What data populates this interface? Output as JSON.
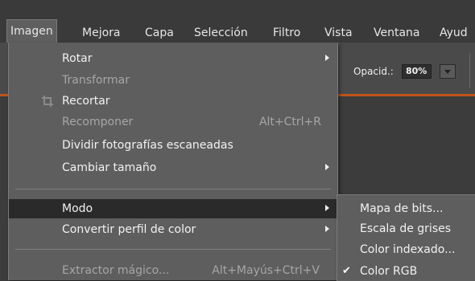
{
  "menubar": {
    "items": [
      "Imagen",
      "Mejora",
      "Capa",
      "Selección",
      "Filtro",
      "Vista",
      "Ventana",
      "Ayud"
    ],
    "active_index": 0
  },
  "options_bar": {
    "opacity_label": "Opacid.:",
    "opacity_value": "80%"
  },
  "image_menu": {
    "items": [
      {
        "label": "Rotar",
        "shortcut": "",
        "enabled": true,
        "submenu": true
      },
      {
        "label": "Transformar",
        "shortcut": "",
        "enabled": false,
        "submenu": false
      },
      {
        "label": "Recortar",
        "shortcut": "",
        "enabled": true,
        "submenu": false,
        "icon": "crop-icon"
      },
      {
        "label": "Recomponer",
        "shortcut": "Alt+Ctrl+R",
        "enabled": false,
        "submenu": false
      },
      {
        "label": "Dividir fotografías escaneadas",
        "shortcut": "",
        "enabled": true,
        "submenu": false
      },
      {
        "label": "Cambiar tamaño",
        "shortcut": "",
        "enabled": true,
        "submenu": true
      },
      {
        "label": "Modo",
        "shortcut": "",
        "enabled": true,
        "submenu": true,
        "highlighted": true
      },
      {
        "label": "Convertir perfil de color",
        "shortcut": "",
        "enabled": true,
        "submenu": true
      },
      {
        "label": "Extractor mágico...",
        "shortcut": "Alt+Mayús+Ctrl+V",
        "enabled": false,
        "submenu": false
      }
    ]
  },
  "mode_submenu": {
    "items": [
      {
        "label": "Mapa de bits...",
        "checked": false
      },
      {
        "label": "Escala de grises",
        "checked": false
      },
      {
        "label": "Color indexado...",
        "checked": false
      },
      {
        "label": "Color RGB",
        "checked": true
      }
    ]
  },
  "colors": {
    "accent": "#c0541a",
    "highlight": "#2a2a2a",
    "menu_bg": "#5e5e5e"
  }
}
